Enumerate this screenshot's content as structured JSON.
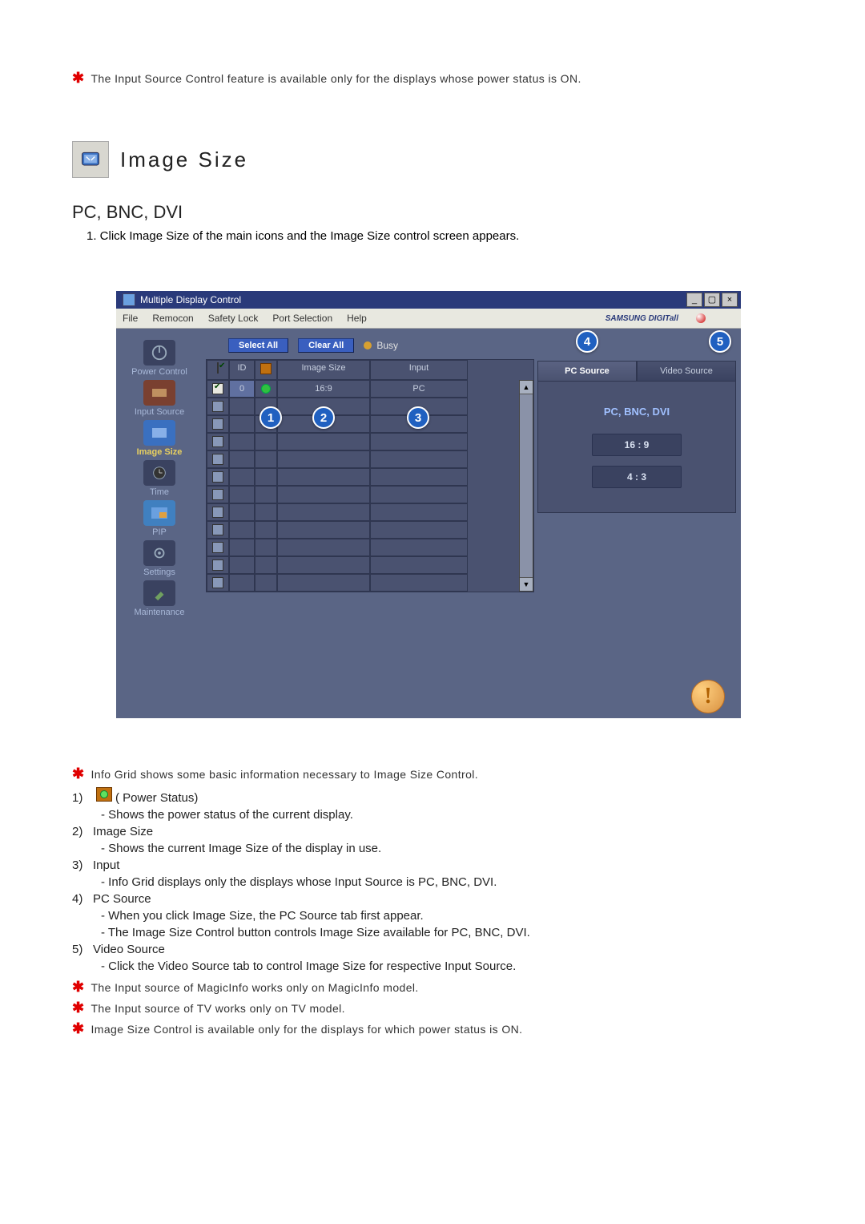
{
  "notes_top": [
    "The Input Source Control feature is available only for the displays whose power status is ON."
  ],
  "section": {
    "title": "Image Size"
  },
  "subhead": "PC, BNC, DVI",
  "intro_step": "1.  Click Image Size of the main icons and the Image Size control screen appears.",
  "window": {
    "title": "Multiple Display Control",
    "menu": [
      "File",
      "Remocon",
      "Safety Lock",
      "Port Selection",
      "Help"
    ],
    "brand": "SAMSUNG DIGITall",
    "buttons": {
      "select_all": "Select All",
      "clear_all": "Clear All",
      "busy": "Busy"
    },
    "sidebar": [
      {
        "label": "Power Control"
      },
      {
        "label": "Input Source"
      },
      {
        "label": "Image Size",
        "active": true
      },
      {
        "label": "Time"
      },
      {
        "label": "PIP"
      },
      {
        "label": "Settings"
      },
      {
        "label": "Maintenance"
      }
    ],
    "grid": {
      "headers": {
        "check": "",
        "id": "ID",
        "status": "",
        "imgsize": "Image Size",
        "input": "Input"
      },
      "rows": [
        {
          "checked": true,
          "id": "0",
          "status_on": true,
          "imgsize": "16:9",
          "input": "PC"
        },
        {
          "checked": false
        },
        {
          "checked": false
        },
        {
          "checked": false
        },
        {
          "checked": false
        },
        {
          "checked": false
        },
        {
          "checked": false
        },
        {
          "checked": false
        },
        {
          "checked": false
        },
        {
          "checked": false
        },
        {
          "checked": false
        },
        {
          "checked": false
        }
      ]
    },
    "callouts": [
      "1",
      "2",
      "3",
      "4",
      "5"
    ],
    "tabs": {
      "pc": "PC Source",
      "video": "Video Source"
    },
    "pc_label": "PC, BNC, DVI",
    "options": [
      "16 : 9",
      "4 : 3"
    ]
  },
  "explain_intro": "Info Grid shows some basic information necessary to Image Size Control.",
  "items": [
    {
      "n": "1)",
      "title": "( Power Status)",
      "icon": true,
      "subs": [
        "- Shows the power status of the current display."
      ]
    },
    {
      "n": "2)",
      "title": "Image Size",
      "subs": [
        "- Shows the current Image Size of the display in use."
      ]
    },
    {
      "n": "3)",
      "title": "Input",
      "subs": [
        "- Info Grid displays only the displays whose Input Source is PC, BNC, DVI."
      ]
    },
    {
      "n": "4)",
      "title": "PC Source",
      "subs": [
        "- When you click Image Size, the PC Source tab first appear.",
        "- The Image Size Control button controls Image Size available for PC, BNC, DVI."
      ]
    },
    {
      "n": "5)",
      "title": "Video Source",
      "subs": [
        "- Click the Video Source tab to control Image Size for respective Input Source."
      ]
    }
  ],
  "notes_bottom": [
    "The Input source of MagicInfo works only on MagicInfo model.",
    "The Input source of TV works only on TV model.",
    "Image Size Control is available only for the displays for which power status is ON."
  ]
}
